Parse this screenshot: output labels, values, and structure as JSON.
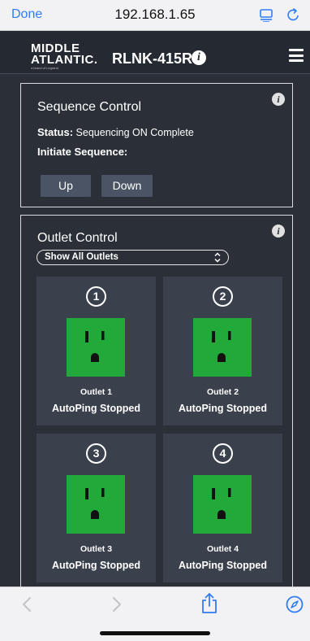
{
  "browser": {
    "done_label": "Done",
    "url": "192.168.1.65",
    "accent_color": "#2f7cf6"
  },
  "header": {
    "logo_line1": "MIDDLE",
    "logo_line2": "ATLANTIC.",
    "logo_sub": "a brand of Legrand",
    "model": "RLNK-415R",
    "info_glyph": "i",
    "menu_icon": "hamburger-icon"
  },
  "sequence": {
    "title": "Sequence Control",
    "info_glyph": "i",
    "status_label": "Status:",
    "status_value": "Sequencing ON Complete",
    "initiate_label": "Initiate Sequence:",
    "up_label": "Up",
    "down_label": "Down"
  },
  "outlet_control": {
    "title": "Outlet Control",
    "info_glyph": "i",
    "filter_selected": "Show All Outlets",
    "outlet_color": "#21a93a",
    "outlets": [
      {
        "number": "1",
        "name": "Outlet 1",
        "status": "AutoPing Stopped"
      },
      {
        "number": "2",
        "name": "Outlet 2",
        "status": "AutoPing Stopped"
      },
      {
        "number": "3",
        "name": "Outlet 3",
        "status": "AutoPing Stopped"
      },
      {
        "number": "4",
        "name": "Outlet 4",
        "status": "AutoPing Stopped"
      }
    ]
  }
}
